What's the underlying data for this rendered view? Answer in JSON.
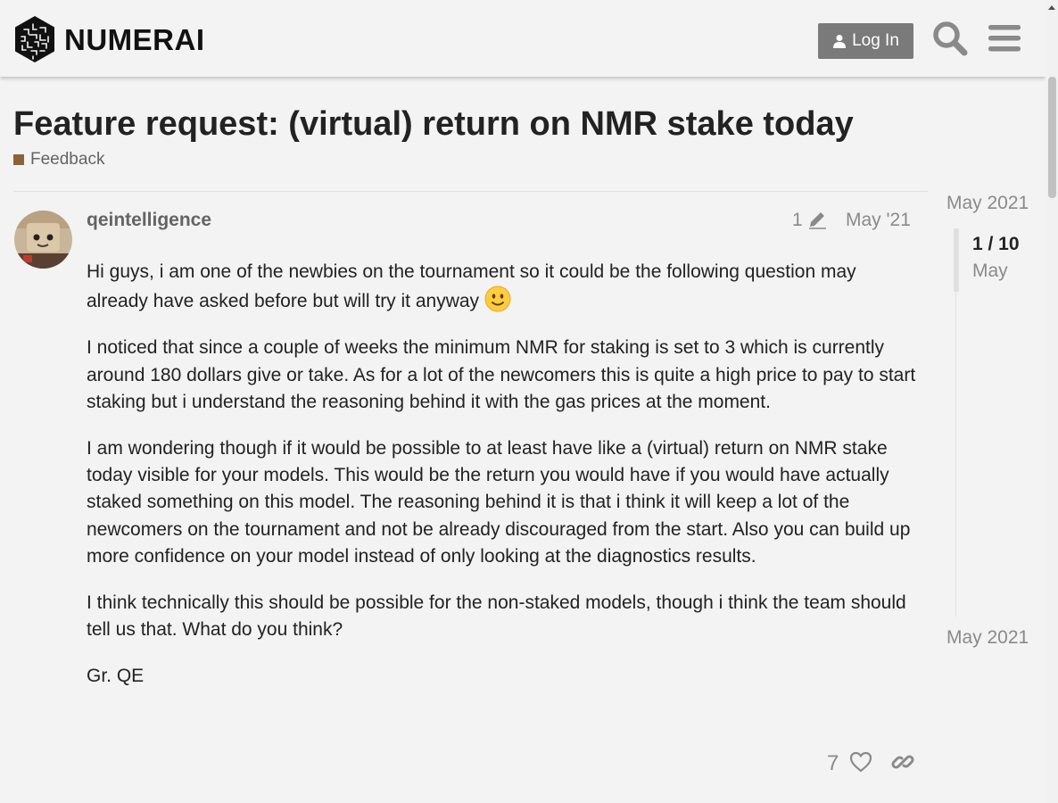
{
  "header": {
    "logo_text": "NUMERAI",
    "login_label": "Log In",
    "search_icon": "search-icon",
    "menu_icon": "hamburger-menu-icon"
  },
  "topic": {
    "title": "Feature request: (virtual) return on NMR stake today",
    "category": "Feedback",
    "category_color": "#8c6238"
  },
  "post": {
    "username": "qeintelligence",
    "edit_count": "1",
    "date": "May '21",
    "paragraphs": [
      "Hi guys, i am one of the newbies on the tournament so it could be the following question may already have asked before but will try it anyway",
      "I noticed that since a couple of weeks the minimum NMR for staking is set to 3 which is currently around 180 dollars give or take. As for a lot of the newcomers this is quite a high price to pay to start staking but i understand the reasoning behind it with the gas prices at the moment.",
      "I am wondering though if it would be possible to at least have like a (virtual) return on NMR stake today visible for your models. This would be the return you would have if you would have actually staked something on this model. The reasoning behind it is that i think it will keep a lot of the newcomers on the tournament and not be already discouraged from the start. Also you can build up more confidence on your model instead of only looking at the diagnostics results.",
      "I think technically this should be possible for the non-staked models, though i think the team should tell us that. What do you think?",
      "Gr. QE"
    ],
    "like_count": "7"
  },
  "timeline": {
    "start": "May 2021",
    "position": "1 / 10",
    "month": "May",
    "end": "May 2021"
  }
}
